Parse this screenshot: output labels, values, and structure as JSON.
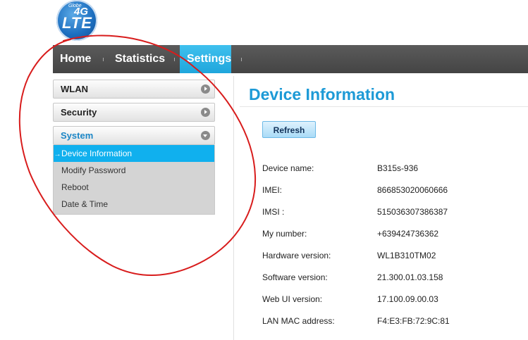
{
  "logo": {
    "brand": "Globe",
    "line1": "4G",
    "line2": "LTE"
  },
  "nav": {
    "items": [
      {
        "label": "Home"
      },
      {
        "label": "Statistics"
      },
      {
        "label": "Settings"
      }
    ],
    "active": "Settings"
  },
  "sidebar": {
    "sections": [
      {
        "label": "WLAN"
      },
      {
        "label": "Security"
      },
      {
        "label": "System"
      }
    ],
    "system_items": [
      {
        "label": "Device Information"
      },
      {
        "label": "Modify Password"
      },
      {
        "label": "Reboot"
      },
      {
        "label": "Date & Time"
      }
    ],
    "active_marker": "→"
  },
  "main": {
    "title": "Device Information",
    "refresh_label": "Refresh",
    "rows": [
      {
        "label": "Device name:",
        "value": "B315s-936"
      },
      {
        "label": "IMEI:",
        "value": "866853020060666"
      },
      {
        "label": "IMSI :",
        "value": "515036307386387"
      },
      {
        "label": "My number:",
        "value": "+639424736362"
      },
      {
        "label": "Hardware version:",
        "value": "WL1B310TM02"
      },
      {
        "label": "Software version:",
        "value": "21.300.01.03.158"
      },
      {
        "label": "Web UI version:",
        "value": "17.100.09.00.03"
      },
      {
        "label": "LAN MAC address:",
        "value": "F4:E3:FB:72:9C:81"
      }
    ]
  },
  "colors": {
    "accent": "#1d9ad6",
    "nav_active": "#1fa6dc",
    "annotation": "#d81c1c"
  }
}
